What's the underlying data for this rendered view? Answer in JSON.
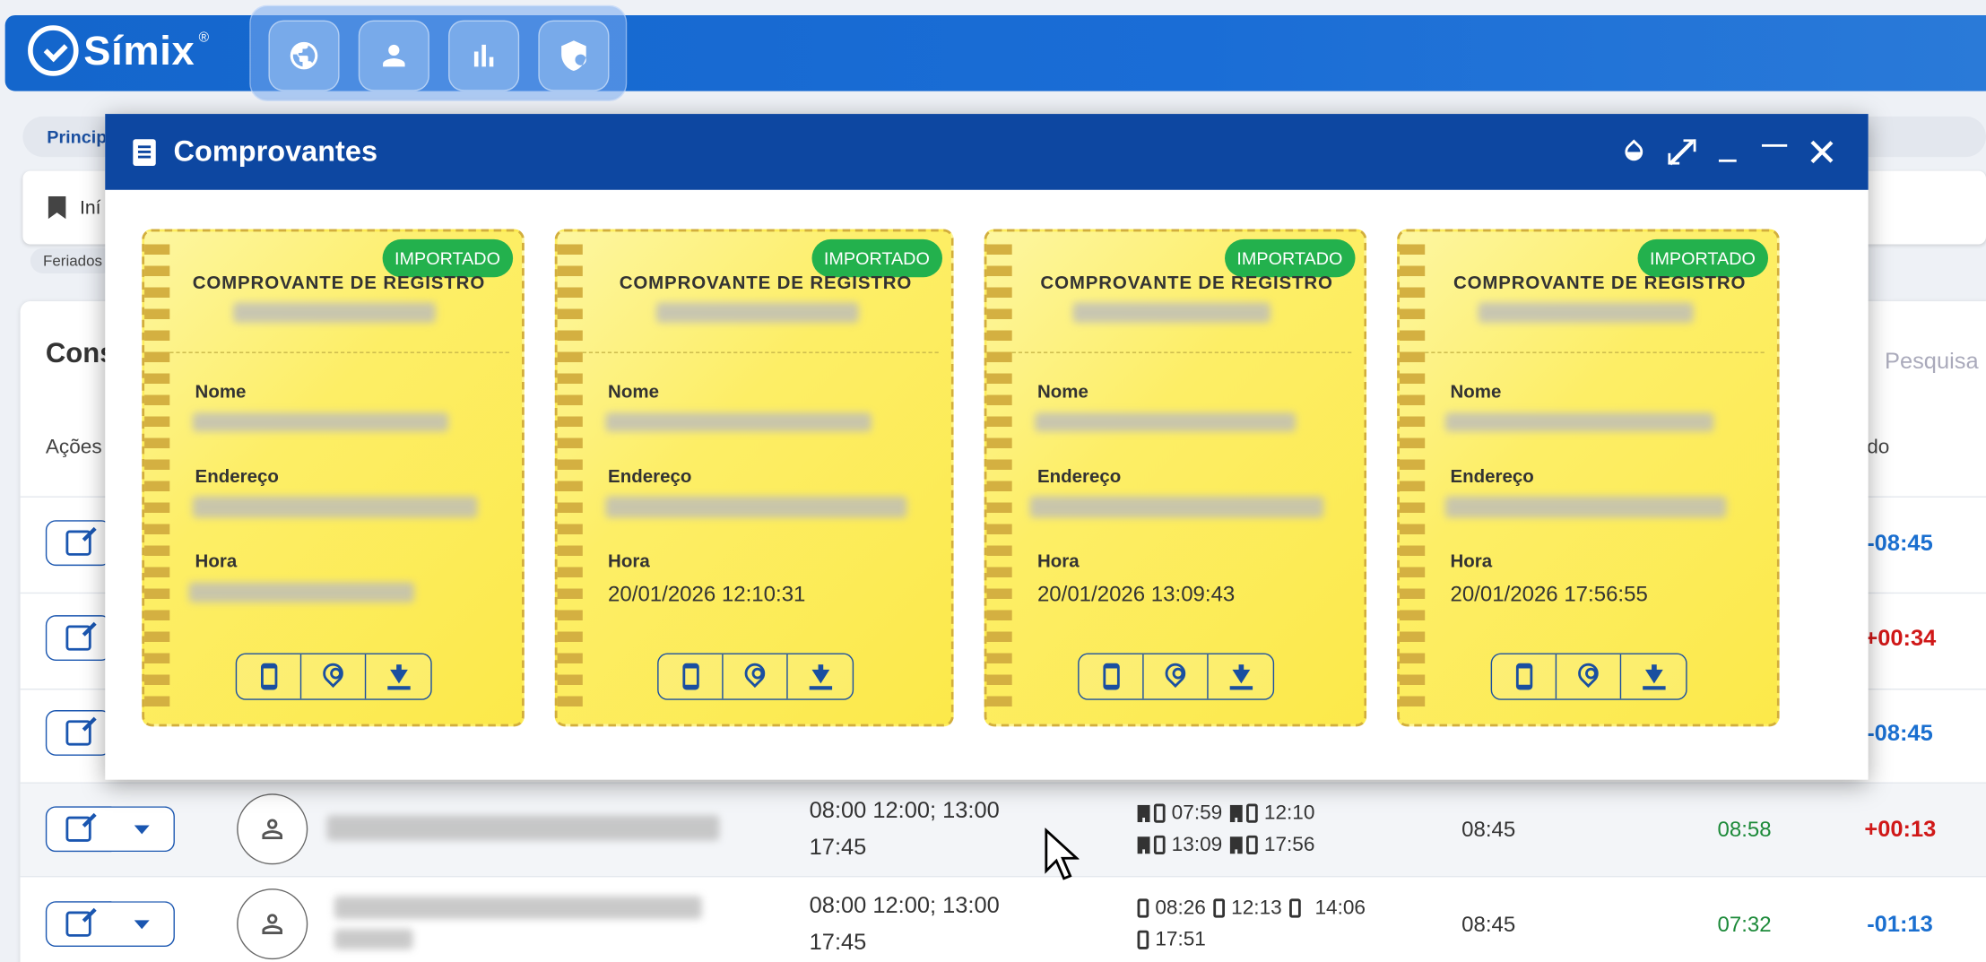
{
  "app": {
    "brand": "Símix",
    "brand_reg": "®",
    "nav": [
      {
        "name": "globe-icon"
      },
      {
        "name": "person-icon"
      },
      {
        "name": "bar-chart-icon"
      },
      {
        "name": "shield-icon"
      }
    ],
    "colors": {
      "header": "#1466cc",
      "modal_header": "#0d47a1",
      "badge": "#23b14d",
      "receipt": "#fce94a"
    }
  },
  "background": {
    "breadcrumb": "Princip",
    "tab": "Iní",
    "chip": "Feriados",
    "title": "Cons",
    "actions_header": "Ações",
    "search_placeholder": "Pesquisa",
    "balance_header": "do",
    "visible_balances": [
      "-08:45",
      "+00:34",
      "-08:45"
    ],
    "rows": [
      {
        "schedule": "08:00 12:00; 13:00 17:45",
        "punches": [
          {
            "time": "07:59",
            "icons": [
              "building",
              "phone"
            ]
          },
          {
            "time": "12:10",
            "icons": [
              "building",
              "phone"
            ]
          },
          {
            "time": "13:09",
            "icons": [
              "building",
              "phone"
            ]
          },
          {
            "time": "17:56",
            "icons": [
              "building",
              "phone"
            ]
          }
        ],
        "expected": "08:45",
        "worked": "08:58",
        "balance": "+00:13"
      },
      {
        "schedule": "08:00 12:00; 13:00 17:45",
        "punches": [
          {
            "time": "08:26",
            "icons": [
              "phone"
            ]
          },
          {
            "time": "12:13",
            "icons": [
              "phone"
            ]
          },
          {
            "time": "14:06",
            "icons": [
              "phone"
            ]
          },
          {
            "time": "17:51",
            "icons": [
              "phone"
            ]
          }
        ],
        "expected": "08:45",
        "worked": "07:32",
        "balance": "-01:13"
      }
    ]
  },
  "modal": {
    "title": "Comprovantes",
    "controls": [
      "opacity-icon",
      "expand-icon",
      "minimize-icon",
      "maximize-icon",
      "close-icon"
    ],
    "receipts": [
      {
        "status": "IMPORTADO",
        "title": "COMPROVANTE DE REGISTRO",
        "name_label": "Nome",
        "address_label": "Endereço",
        "time_label": "Hora",
        "time": ""
      },
      {
        "status": "IMPORTADO",
        "title": "COMPROVANTE DE REGISTRO",
        "name_label": "Nome",
        "address_label": "Endereço",
        "time_label": "Hora",
        "time": "20/01/2026 12:10:31"
      },
      {
        "status": "IMPORTADO",
        "title": "COMPROVANTE DE REGISTRO",
        "name_label": "Nome",
        "address_label": "Endereço",
        "time_label": "Hora",
        "time": "20/01/2026 13:09:43"
      },
      {
        "status": "IMPORTADO",
        "title": "COMPROVANTE DE REGISTRO",
        "name_label": "Nome",
        "address_label": "Endereço",
        "time_label": "Hora",
        "time": "20/01/2026 17:56:55"
      }
    ]
  }
}
